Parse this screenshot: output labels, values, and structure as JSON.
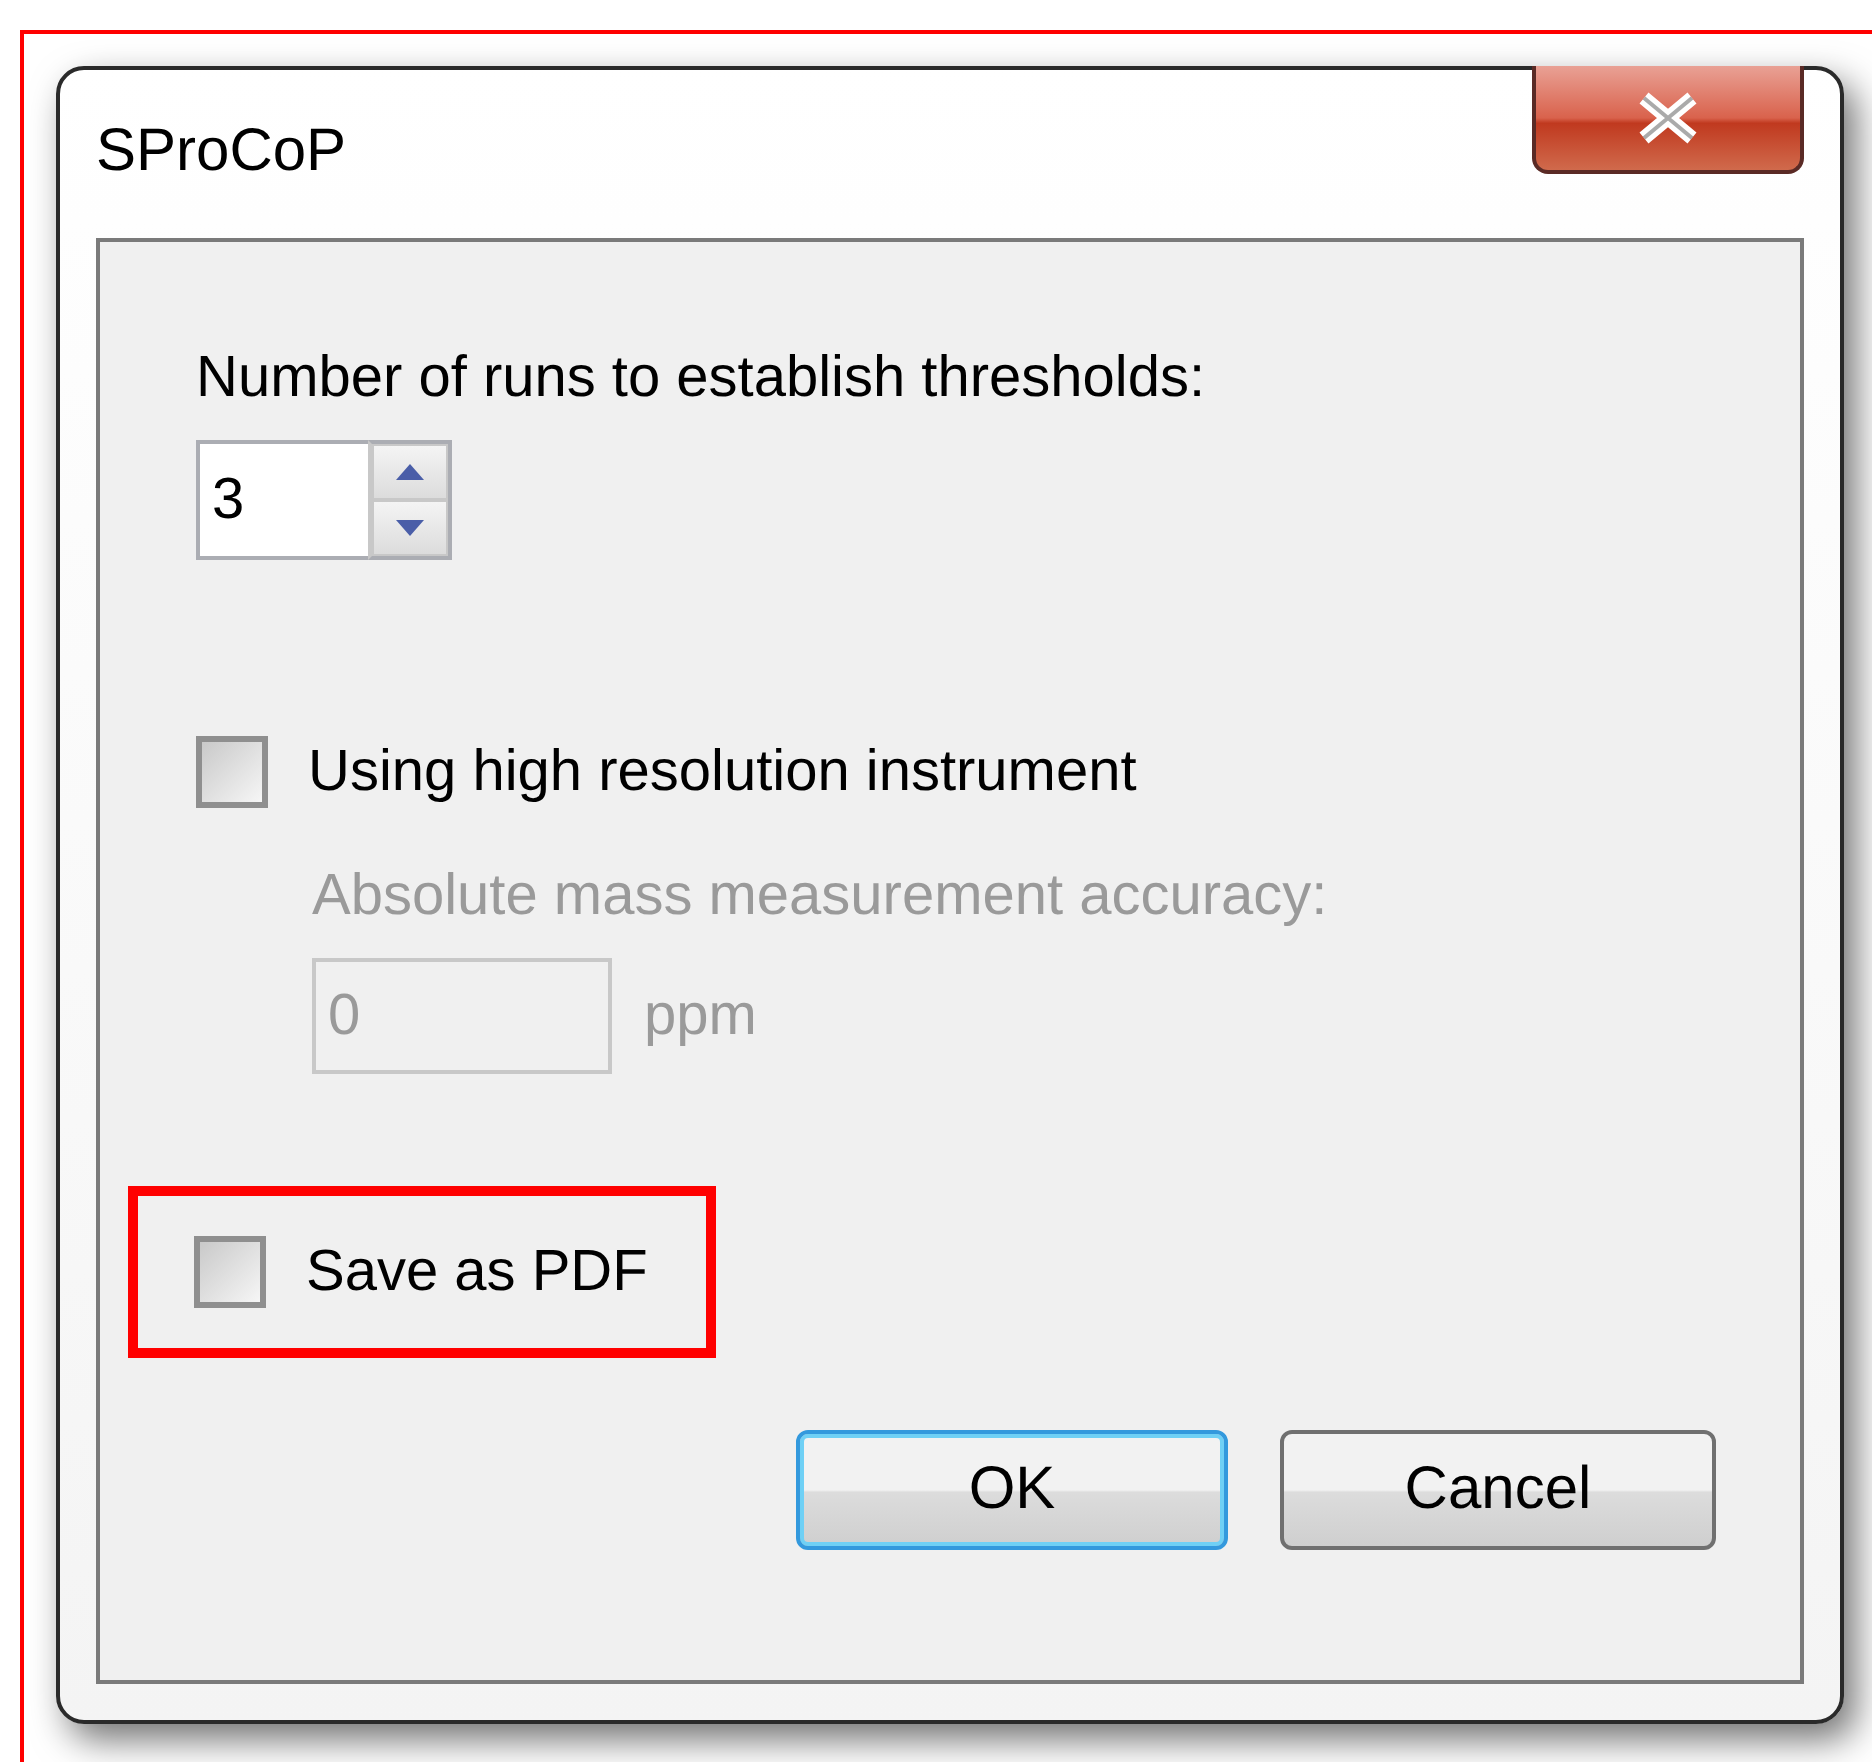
{
  "window": {
    "title": "SProCoP"
  },
  "runs": {
    "label": "Number of runs to establish thresholds:",
    "value": "3"
  },
  "high_resolution": {
    "label": "Using high resolution instrument",
    "checked": false
  },
  "accuracy": {
    "label": "Absolute mass measurement accuracy:",
    "value": "0",
    "unit": "ppm",
    "disabled": true
  },
  "save_pdf": {
    "label": "Save as PDF",
    "checked": false,
    "highlighted": true
  },
  "buttons": [
    {
      "label": "OK",
      "default": true
    },
    {
      "label": "Cancel",
      "default": false
    }
  ]
}
